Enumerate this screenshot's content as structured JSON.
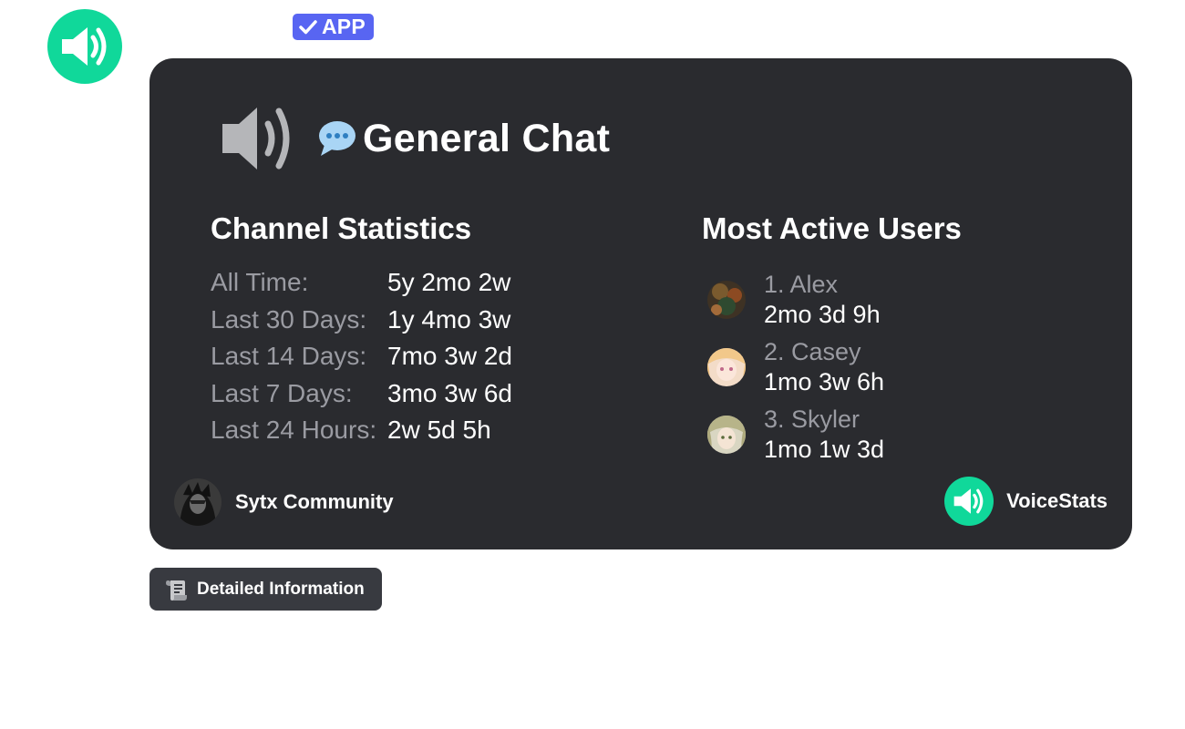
{
  "app_badge": {
    "label": "APP",
    "color": "#5865f2"
  },
  "bot_avatar": {
    "icon": "speaker-icon",
    "color": "#10d89a"
  },
  "card": {
    "background": "#2a2b2f",
    "channel": {
      "icon": "speaker-icon",
      "emoji_icon": "speech-bubble-icon",
      "name": "General Chat"
    },
    "stats": {
      "title": "Channel Statistics",
      "rows": [
        {
          "label": "All Time:",
          "value": "5y 2mo 2w"
        },
        {
          "label": "Last 30 Days:",
          "value": "1y 4mo 3w"
        },
        {
          "label": "Last 14 Days:",
          "value": "7mo 3w 2d"
        },
        {
          "label": "Last 7 Days:",
          "value": "3mo 3w 6d"
        },
        {
          "label": "Last 24 Hours:",
          "value": "2w 5d 5h"
        }
      ]
    },
    "users": {
      "title": "Most Active Users",
      "items": [
        {
          "name": "1. Alex",
          "time": "2mo 3d 9h"
        },
        {
          "name": "2. Casey",
          "time": "1mo 3w 6h"
        },
        {
          "name": "3. Skyler",
          "time": "1mo 1w 3d"
        }
      ]
    },
    "footer": {
      "server_name": "Sytx Community",
      "brand_name": "VoiceStats",
      "brand_color": "#10d89a"
    }
  },
  "detail_button": {
    "icon": "scroll-icon",
    "label": "Detailed Information"
  }
}
